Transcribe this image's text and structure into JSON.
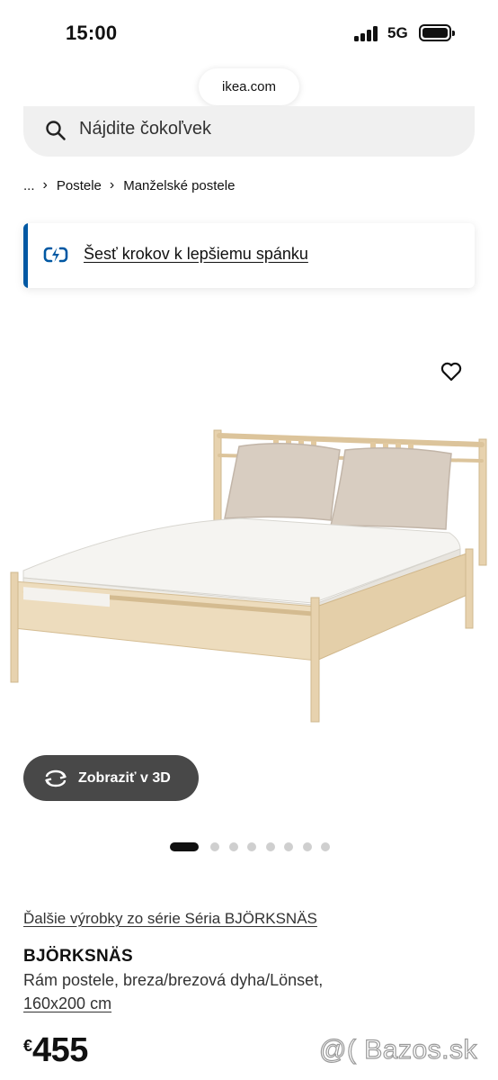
{
  "status_bar": {
    "time": "15:00",
    "network": "5G",
    "icons": [
      "signal-icon",
      "battery-icon"
    ]
  },
  "browser": {
    "url": "ikea.com"
  },
  "search": {
    "placeholder": "Nájdite čokoľvek",
    "icon": "search-icon"
  },
  "breadcrumb": {
    "items": [
      "...",
      "Postele",
      "Manželské postele"
    ]
  },
  "promo": {
    "text": "Šesť krokov k lepšiemu spánku",
    "icon": "moon-bolt-icon",
    "accent_color": "#0058a3"
  },
  "gallery": {
    "view_3d_label": "Zobraziť v 3D",
    "image_count": 8,
    "active_index": 0
  },
  "product": {
    "series_link": "Ďalšie výrobky zo série Séria BJÖRKSNÄS",
    "name": "BJÖRKSNÄS",
    "description": "Rám postele, breza/brezová dyha/Lönset,",
    "size": "160x200 cm",
    "currency": "€",
    "price": "455"
  },
  "watermark": "@( Bazos.sk"
}
